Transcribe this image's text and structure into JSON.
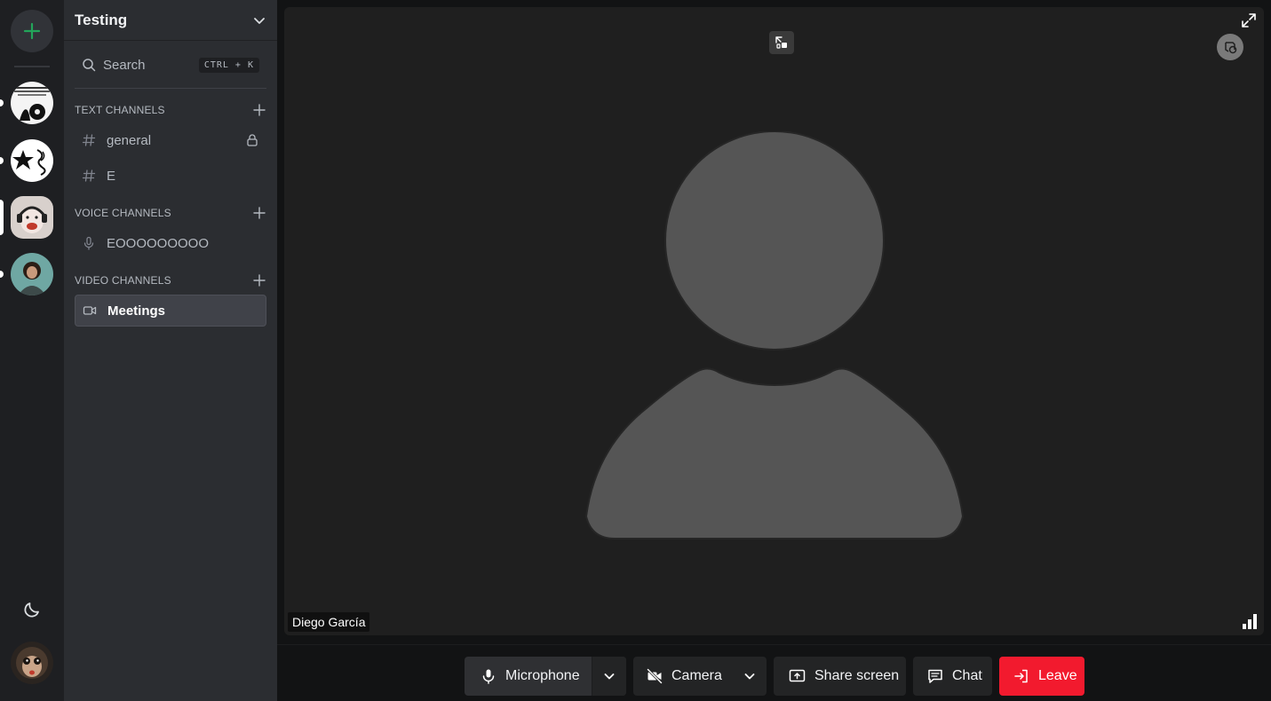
{
  "server_rail": {
    "add_server_icon": "plus-icon",
    "servers": [
      {
        "name": "server-1",
        "has_unread": true
      },
      {
        "name": "server-2",
        "has_unread": true
      },
      {
        "name": "server-3",
        "selected": true
      },
      {
        "name": "server-4",
        "has_unread": true
      }
    ],
    "theme_toggle_icon": "moon-icon",
    "user_avatar": "monkey-avatar"
  },
  "sidebar": {
    "guild_name": "Testing",
    "search": {
      "label": "Search",
      "shortcut": "CTRL + K"
    },
    "categories": {
      "text": {
        "label": "TEXT CHANNELS",
        "channels": [
          {
            "label": "general",
            "icon": "hash-icon",
            "locked": true
          },
          {
            "label": "E",
            "icon": "hash-icon"
          }
        ]
      },
      "voice": {
        "label": "VOICE CHANNELS",
        "channels": [
          {
            "label": "EOOOOOOOOO",
            "icon": "microphone-icon"
          }
        ]
      },
      "video": {
        "label": "VIDEO CHANNELS",
        "channels": [
          {
            "label": "Meetings",
            "icon": "video-icon",
            "active": true
          }
        ]
      }
    }
  },
  "stage": {
    "participant": {
      "name": "Diego García"
    },
    "icons": [
      "focus-toggle-icon",
      "expand-icon",
      "connection-quality-icon"
    ]
  },
  "controls": {
    "microphone": "Microphone",
    "camera": "Camera",
    "share_screen": "Share screen",
    "chat": "Chat",
    "leave": "Leave"
  },
  "colors": {
    "accent_green": "#23a55a",
    "leave_red": "#f21a2e",
    "active_channel": "#404249",
    "placeholder_gray": "#555555"
  }
}
